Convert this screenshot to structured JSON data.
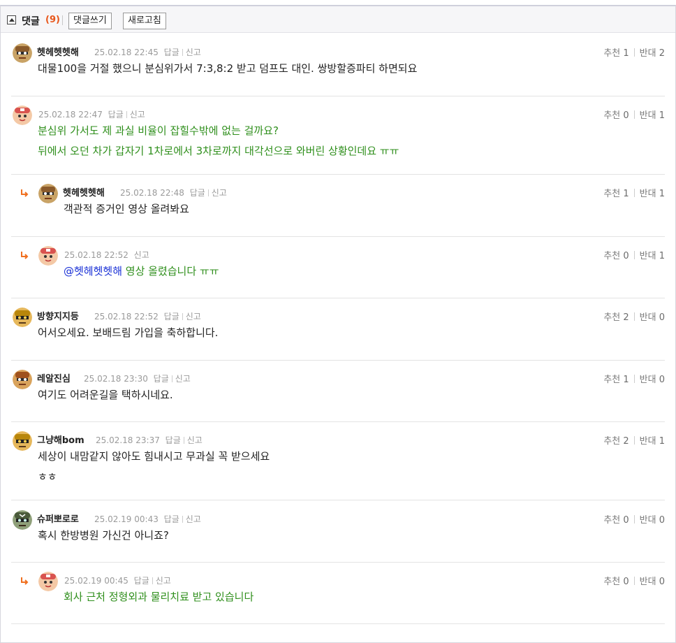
{
  "header": {
    "title": "댓글",
    "count": "(9)",
    "write_button": "댓글쓰기",
    "refresh_button": "새로고침"
  },
  "labels": {
    "reply": "답글",
    "report": "신고",
    "upvote": "추천",
    "downvote": "반대"
  },
  "comments": [
    {
      "nick": "헷헤헷헷해",
      "date": "25.02.18 22:45",
      "up": "1",
      "down": "2",
      "lines": [
        "대물100을 거절 했으니 분심위가서 7:3,8:2 받고 덤프도 대인. 쌍방할증파티 하면되요"
      ]
    },
    {
      "nick": "",
      "date": "25.02.18 22:47",
      "up": "0",
      "down": "1",
      "lines": [
        "분심위 가서도 제 과실 비율이 잡힐수밖에 없는 걸까요?",
        "뒤에서 오던 차가 갑자기 1차로에서 3차로까지 대각선으로 와버린 상황인데요 ㅠㅠ"
      ]
    },
    {
      "nick": "헷헤헷헷해",
      "date": "25.02.18 22:48",
      "up": "1",
      "down": "1",
      "lines": [
        "객관적 증거인 영상 올려봐요"
      ]
    },
    {
      "nick": "",
      "date": "25.02.18 22:52",
      "up": "0",
      "down": "1",
      "mention": "@헷헤헷헷해",
      "lines": [
        " 영상 올렸습니다 ㅠㅠ"
      ]
    },
    {
      "nick": "방향지지등",
      "date": "25.02.18 22:52",
      "up": "2",
      "down": "0",
      "lines": [
        "어서오세요. 보배드림 가입을 축하합니다."
      ]
    },
    {
      "nick": "레알진심",
      "date": "25.02.18 23:30",
      "up": "1",
      "down": "0",
      "lines": [
        "여기도 어려운길을 택하시네요."
      ]
    },
    {
      "nick": "그냥해bom",
      "date": "25.02.18 23:37",
      "up": "2",
      "down": "1",
      "lines": [
        "세상이 내맘같지 않아도 힘내시고 무과실 꼭 받으세요",
        "ㅎㅎ"
      ]
    },
    {
      "nick": "슈퍼뽀로로",
      "date": "25.02.19 00:43",
      "up": "0",
      "down": "0",
      "lines": [
        "혹시 한방병원 가신건 아니죠?"
      ]
    },
    {
      "nick": "",
      "date": "25.02.19 00:45",
      "up": "0",
      "down": "0",
      "lines": [
        "회사 근처 정형외과 물리치료 받고 있습니다"
      ]
    }
  ],
  "colors": {
    "accent_count": "#e8571b",
    "author_text": "#2f8f1c",
    "mention": "#1930d6",
    "reply_arrow": "#f07020"
  },
  "icons": [
    "toggle-icon",
    "reply-arrow-icon",
    "avatar-icon"
  ]
}
